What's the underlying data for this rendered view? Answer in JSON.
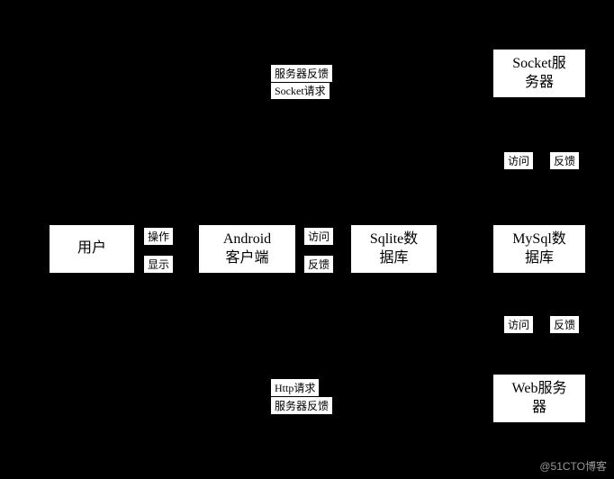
{
  "nodes": {
    "user": "用户",
    "android": "Android\n客户端",
    "sqlite": "Sqlite数\n据库",
    "mysql": "MySql数\n据库",
    "socket": "Socket服\n务器",
    "web": "Web服务\n器"
  },
  "edges": {
    "user_to_android": "操作",
    "android_to_user": "显示",
    "android_to_sqlite": "访问",
    "sqlite_to_android": "反馈",
    "android_to_socket": "Socket请求",
    "socket_to_android": "服务器反馈",
    "android_to_web": "Http请求",
    "web_to_android": "服务器反馈",
    "socket_to_mysql": "访问",
    "mysql_to_socket": "反馈",
    "web_to_mysql": "访问",
    "mysql_to_web": "反馈"
  },
  "watermark": "@51CTO博客"
}
